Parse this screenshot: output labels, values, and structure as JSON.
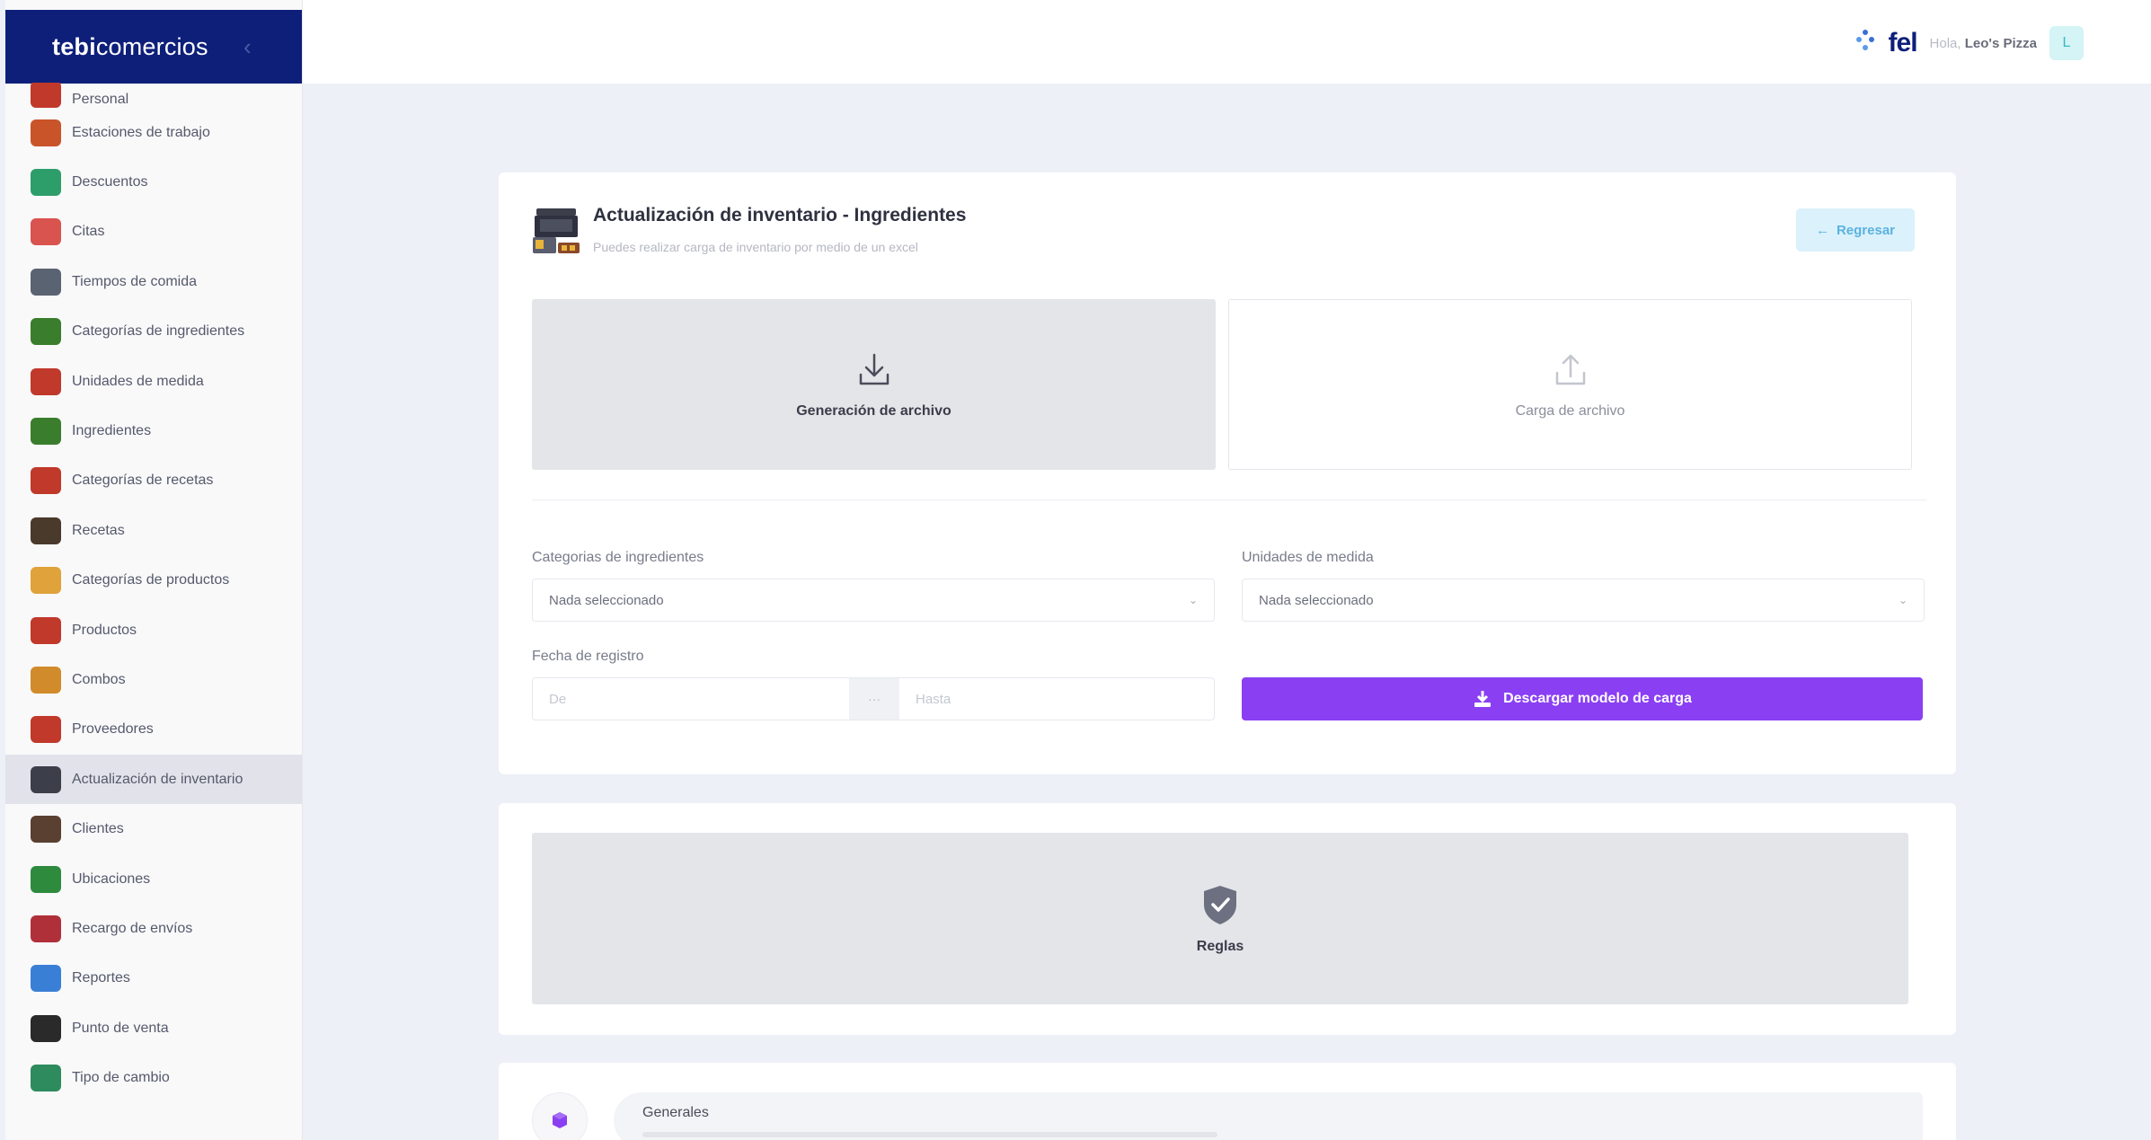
{
  "brand": {
    "name_bold": "ebi",
    "name_rest": "comercios",
    "mark": "t"
  },
  "sidebar": {
    "items": [
      {
        "label": "Personal",
        "icon": "people-icon",
        "color": "#c0392b",
        "cut": true
      },
      {
        "label": "Estaciones de trabajo",
        "icon": "cash-register-icon",
        "color": "#c9542a"
      },
      {
        "label": "Descuentos",
        "icon": "discount-globe-icon",
        "color": "#2d9e6a"
      },
      {
        "label": "Citas",
        "icon": "calendar-icon",
        "color": "#d9534f"
      },
      {
        "label": "Tiempos de comida",
        "icon": "meal-time-icon",
        "color": "#5a6372"
      },
      {
        "label": "Categorías de ingredientes",
        "icon": "ingredients-category-icon",
        "color": "#3a7d2c"
      },
      {
        "label": "Unidades de medida",
        "icon": "ladle-icon",
        "color": "#c0392b"
      },
      {
        "label": "Ingredientes",
        "icon": "ingredients-icon",
        "color": "#3a7d2c"
      },
      {
        "label": "Categorías de recetas",
        "icon": "recipe-category-icon",
        "color": "#c0392b"
      },
      {
        "label": "Recetas",
        "icon": "recipe-book-icon",
        "color": "#4a3a2c"
      },
      {
        "label": "Categorías de productos",
        "icon": "product-category-icon",
        "color": "#e0a23a"
      },
      {
        "label": "Productos",
        "icon": "cart-icon",
        "color": "#c0392b"
      },
      {
        "label": "Combos",
        "icon": "combo-icon",
        "color": "#d18b2a"
      },
      {
        "label": "Proveedores",
        "icon": "supplier-icon",
        "color": "#c0392b"
      },
      {
        "label": "Actualización de inventario",
        "icon": "inventory-update-icon",
        "color": "#3c3f4a",
        "active": true
      },
      {
        "label": "Clientes",
        "icon": "client-icon",
        "color": "#5a4030"
      },
      {
        "label": "Ubicaciones",
        "icon": "location-icon",
        "color": "#2e8b3e"
      },
      {
        "label": "Recargo de envíos",
        "icon": "delivery-icon",
        "color": "#b0303a"
      },
      {
        "label": "Reportes",
        "icon": "reports-icon",
        "color": "#3a7fd6"
      },
      {
        "label": "Punto de venta",
        "icon": "pos-icon",
        "color": "#2a2a2a"
      },
      {
        "label": "Tipo de cambio",
        "icon": "exchange-icon",
        "color": "#2e8b5e"
      }
    ]
  },
  "topbar": {
    "fel_logo": "fel",
    "greeting": "Hola,",
    "user_name": "Leo's Pizza",
    "avatar_initial": "L"
  },
  "page": {
    "title": "Actualización de inventario - Ingredientes",
    "subtitle": "Puedes realizar carga de inventario por medio de un excel",
    "back_label": "Regresar",
    "options": {
      "generate": "Generación de archivo",
      "upload": "Carga de archivo"
    },
    "filters": {
      "ingredient_categories_label": "Categorias de ingredientes",
      "ingredient_categories_value": "Nada seleccionado",
      "units_label": "Unidades de medida",
      "units_value": "Nada seleccionado",
      "date_label": "Fecha de registro",
      "date_from_placeholder": "De",
      "date_separator": "···",
      "date_to_placeholder": "Hasta"
    },
    "download_label": "Descargar modelo de carga"
  },
  "rules": {
    "label": "Reglas"
  },
  "general": {
    "title": "Generales"
  },
  "colors": {
    "brand": "#0e1f7a",
    "accent": "#8a3ff3",
    "back_button_bg": "#dbf1fb",
    "back_button_text": "#5bb2e0"
  }
}
